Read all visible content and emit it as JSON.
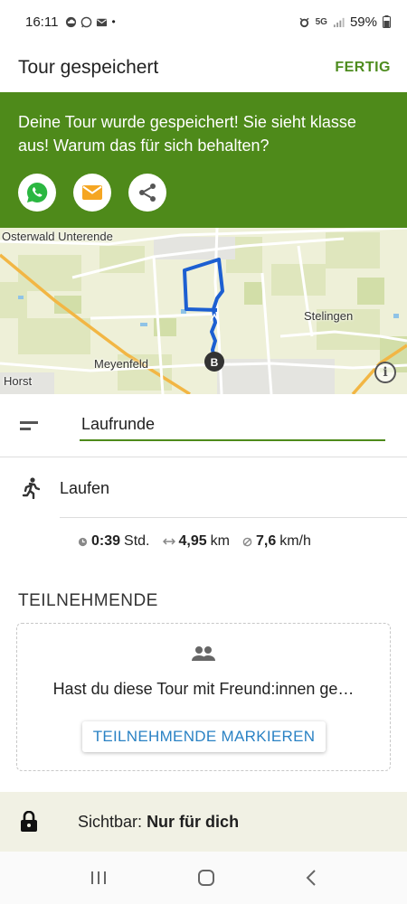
{
  "status_bar": {
    "time": "16:11",
    "network": "5G",
    "battery": "59%"
  },
  "app_bar": {
    "title": "Tour gespeichert",
    "done_label": "FERTIG"
  },
  "banner": {
    "message": "Deine Tour wurde gespeichert! Sie sieht klasse aus! Warum das für sich behalten?",
    "share_buttons": [
      "whatsapp-icon",
      "email-icon",
      "share-icon"
    ]
  },
  "map": {
    "labels": {
      "osterwald": "Osterwald Unterende",
      "stelingen": "Stelingen",
      "meyenfeld": "Meyenfeld",
      "horst": "Horst"
    },
    "end_marker": "B"
  },
  "tour": {
    "name": "Laufrunde",
    "sport": "Laufen"
  },
  "stats": {
    "duration_value": "0:39",
    "duration_unit": "Std.",
    "distance_value": "4,95",
    "distance_unit": "km",
    "speed_value": "7,6",
    "speed_unit": "km/h"
  },
  "participants": {
    "section_title": "TEILNEHMENDE",
    "prompt": "Hast du diese Tour mit Freund:innen ge…",
    "button_label": "TEILNEHMENDE MARKIEREN"
  },
  "visibility": {
    "label": "Sichtbar:",
    "value": "Nur für dich"
  },
  "colors": {
    "accent_green": "#4e8a1a",
    "link_blue": "#2a82c4",
    "route_blue": "#1c5fd1"
  }
}
